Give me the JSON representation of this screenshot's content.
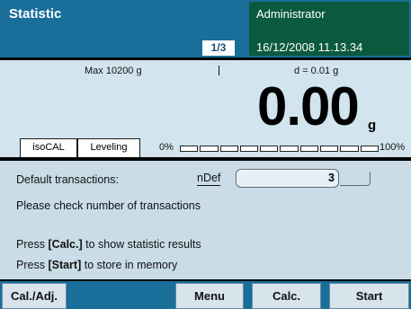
{
  "header": {
    "title": "Statistic",
    "page_indicator": "1/3",
    "user": "Administrator",
    "datetime": "16/12/2008 11.13.34"
  },
  "weighing": {
    "max_label": "Max 10200 g",
    "readability_label": "d = 0.01 g",
    "value": "0.00",
    "unit": "g",
    "tabs": [
      "isoCAL",
      "Leveling"
    ],
    "capacity_min_label": "0%",
    "capacity_max_label": "100%",
    "capacity_fraction": 0
  },
  "content": {
    "field_label": "Default transactions:",
    "field_tag": "nDef",
    "field_value": "3",
    "check_text": "Please check number of transactions",
    "calc_prefix": "Press ",
    "calc_key": "[Calc.]",
    "calc_suffix": " to show statistic results",
    "start_prefix": "Press ",
    "start_key": "[Start]",
    "start_suffix": " to store in memory"
  },
  "softkeys": {
    "cal_adj": "Cal./Adj.",
    "menu": "Menu",
    "calc": "Calc.",
    "start": "Start"
  },
  "colors": {
    "header_blue": "#1a6e9a",
    "user_green": "#0b5a3f",
    "panel_blue": "#d2e4ee"
  }
}
